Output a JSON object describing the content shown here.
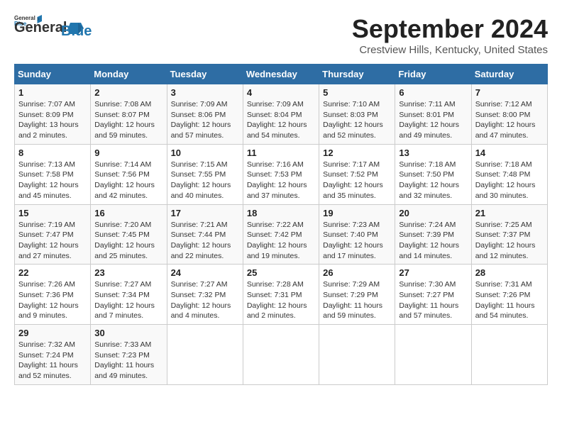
{
  "header": {
    "logo_line1": "General",
    "logo_line2": "Blue",
    "month": "September 2024",
    "location": "Crestview Hills, Kentucky, United States"
  },
  "weekdays": [
    "Sunday",
    "Monday",
    "Tuesday",
    "Wednesday",
    "Thursday",
    "Friday",
    "Saturday"
  ],
  "weeks": [
    [
      {
        "day": "1",
        "sunrise": "Sunrise: 7:07 AM",
        "sunset": "Sunset: 8:09 PM",
        "daylight": "Daylight: 13 hours and 2 minutes."
      },
      {
        "day": "2",
        "sunrise": "Sunrise: 7:08 AM",
        "sunset": "Sunset: 8:07 PM",
        "daylight": "Daylight: 12 hours and 59 minutes."
      },
      {
        "day": "3",
        "sunrise": "Sunrise: 7:09 AM",
        "sunset": "Sunset: 8:06 PM",
        "daylight": "Daylight: 12 hours and 57 minutes."
      },
      {
        "day": "4",
        "sunrise": "Sunrise: 7:09 AM",
        "sunset": "Sunset: 8:04 PM",
        "daylight": "Daylight: 12 hours and 54 minutes."
      },
      {
        "day": "5",
        "sunrise": "Sunrise: 7:10 AM",
        "sunset": "Sunset: 8:03 PM",
        "daylight": "Daylight: 12 hours and 52 minutes."
      },
      {
        "day": "6",
        "sunrise": "Sunrise: 7:11 AM",
        "sunset": "Sunset: 8:01 PM",
        "daylight": "Daylight: 12 hours and 49 minutes."
      },
      {
        "day": "7",
        "sunrise": "Sunrise: 7:12 AM",
        "sunset": "Sunset: 8:00 PM",
        "daylight": "Daylight: 12 hours and 47 minutes."
      }
    ],
    [
      {
        "day": "8",
        "sunrise": "Sunrise: 7:13 AM",
        "sunset": "Sunset: 7:58 PM",
        "daylight": "Daylight: 12 hours and 45 minutes."
      },
      {
        "day": "9",
        "sunrise": "Sunrise: 7:14 AM",
        "sunset": "Sunset: 7:56 PM",
        "daylight": "Daylight: 12 hours and 42 minutes."
      },
      {
        "day": "10",
        "sunrise": "Sunrise: 7:15 AM",
        "sunset": "Sunset: 7:55 PM",
        "daylight": "Daylight: 12 hours and 40 minutes."
      },
      {
        "day": "11",
        "sunrise": "Sunrise: 7:16 AM",
        "sunset": "Sunset: 7:53 PM",
        "daylight": "Daylight: 12 hours and 37 minutes."
      },
      {
        "day": "12",
        "sunrise": "Sunrise: 7:17 AM",
        "sunset": "Sunset: 7:52 PM",
        "daylight": "Daylight: 12 hours and 35 minutes."
      },
      {
        "day": "13",
        "sunrise": "Sunrise: 7:18 AM",
        "sunset": "Sunset: 7:50 PM",
        "daylight": "Daylight: 12 hours and 32 minutes."
      },
      {
        "day": "14",
        "sunrise": "Sunrise: 7:18 AM",
        "sunset": "Sunset: 7:48 PM",
        "daylight": "Daylight: 12 hours and 30 minutes."
      }
    ],
    [
      {
        "day": "15",
        "sunrise": "Sunrise: 7:19 AM",
        "sunset": "Sunset: 7:47 PM",
        "daylight": "Daylight: 12 hours and 27 minutes."
      },
      {
        "day": "16",
        "sunrise": "Sunrise: 7:20 AM",
        "sunset": "Sunset: 7:45 PM",
        "daylight": "Daylight: 12 hours and 25 minutes."
      },
      {
        "day": "17",
        "sunrise": "Sunrise: 7:21 AM",
        "sunset": "Sunset: 7:44 PM",
        "daylight": "Daylight: 12 hours and 22 minutes."
      },
      {
        "day": "18",
        "sunrise": "Sunrise: 7:22 AM",
        "sunset": "Sunset: 7:42 PM",
        "daylight": "Daylight: 12 hours and 19 minutes."
      },
      {
        "day": "19",
        "sunrise": "Sunrise: 7:23 AM",
        "sunset": "Sunset: 7:40 PM",
        "daylight": "Daylight: 12 hours and 17 minutes."
      },
      {
        "day": "20",
        "sunrise": "Sunrise: 7:24 AM",
        "sunset": "Sunset: 7:39 PM",
        "daylight": "Daylight: 12 hours and 14 minutes."
      },
      {
        "day": "21",
        "sunrise": "Sunrise: 7:25 AM",
        "sunset": "Sunset: 7:37 PM",
        "daylight": "Daylight: 12 hours and 12 minutes."
      }
    ],
    [
      {
        "day": "22",
        "sunrise": "Sunrise: 7:26 AM",
        "sunset": "Sunset: 7:36 PM",
        "daylight": "Daylight: 12 hours and 9 minutes."
      },
      {
        "day": "23",
        "sunrise": "Sunrise: 7:27 AM",
        "sunset": "Sunset: 7:34 PM",
        "daylight": "Daylight: 12 hours and 7 minutes."
      },
      {
        "day": "24",
        "sunrise": "Sunrise: 7:27 AM",
        "sunset": "Sunset: 7:32 PM",
        "daylight": "Daylight: 12 hours and 4 minutes."
      },
      {
        "day": "25",
        "sunrise": "Sunrise: 7:28 AM",
        "sunset": "Sunset: 7:31 PM",
        "daylight": "Daylight: 12 hours and 2 minutes."
      },
      {
        "day": "26",
        "sunrise": "Sunrise: 7:29 AM",
        "sunset": "Sunset: 7:29 PM",
        "daylight": "Daylight: 11 hours and 59 minutes."
      },
      {
        "day": "27",
        "sunrise": "Sunrise: 7:30 AM",
        "sunset": "Sunset: 7:27 PM",
        "daylight": "Daylight: 11 hours and 57 minutes."
      },
      {
        "day": "28",
        "sunrise": "Sunrise: 7:31 AM",
        "sunset": "Sunset: 7:26 PM",
        "daylight": "Daylight: 11 hours and 54 minutes."
      }
    ],
    [
      {
        "day": "29",
        "sunrise": "Sunrise: 7:32 AM",
        "sunset": "Sunset: 7:24 PM",
        "daylight": "Daylight: 11 hours and 52 minutes."
      },
      {
        "day": "30",
        "sunrise": "Sunrise: 7:33 AM",
        "sunset": "Sunset: 7:23 PM",
        "daylight": "Daylight: 11 hours and 49 minutes."
      },
      null,
      null,
      null,
      null,
      null
    ]
  ]
}
